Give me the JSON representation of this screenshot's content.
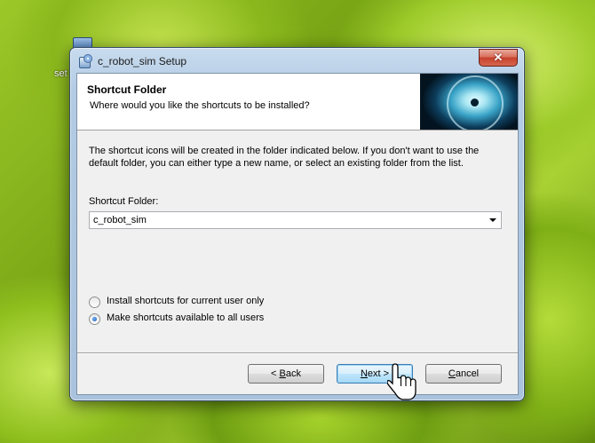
{
  "desktop": {
    "icon_name": "installer-icon",
    "label": "set"
  },
  "window": {
    "title": "c_robot_sim Setup",
    "close_glyph": "✕"
  },
  "header": {
    "title": "Shortcut Folder",
    "subtitle": "Where would you like the shortcuts to be installed?"
  },
  "body": {
    "info": "The shortcut icons will be created in the folder indicated below. If you don't want to use the default folder, you can either type a new name, or select an existing folder from the list.",
    "field_label": "Shortcut Folder:",
    "folder_value": "c_robot_sim",
    "options": [
      {
        "label": "Install shortcuts for current user only",
        "checked": false
      },
      {
        "label": "Make shortcuts available to all users",
        "checked": true
      }
    ]
  },
  "buttons": {
    "back": {
      "prefix": "< ",
      "mnemonic": "B",
      "rest": "ack"
    },
    "next": {
      "mnemonic": "N",
      "rest": "ext >"
    },
    "cancel": {
      "mnemonic": "C",
      "rest": "ancel"
    }
  }
}
